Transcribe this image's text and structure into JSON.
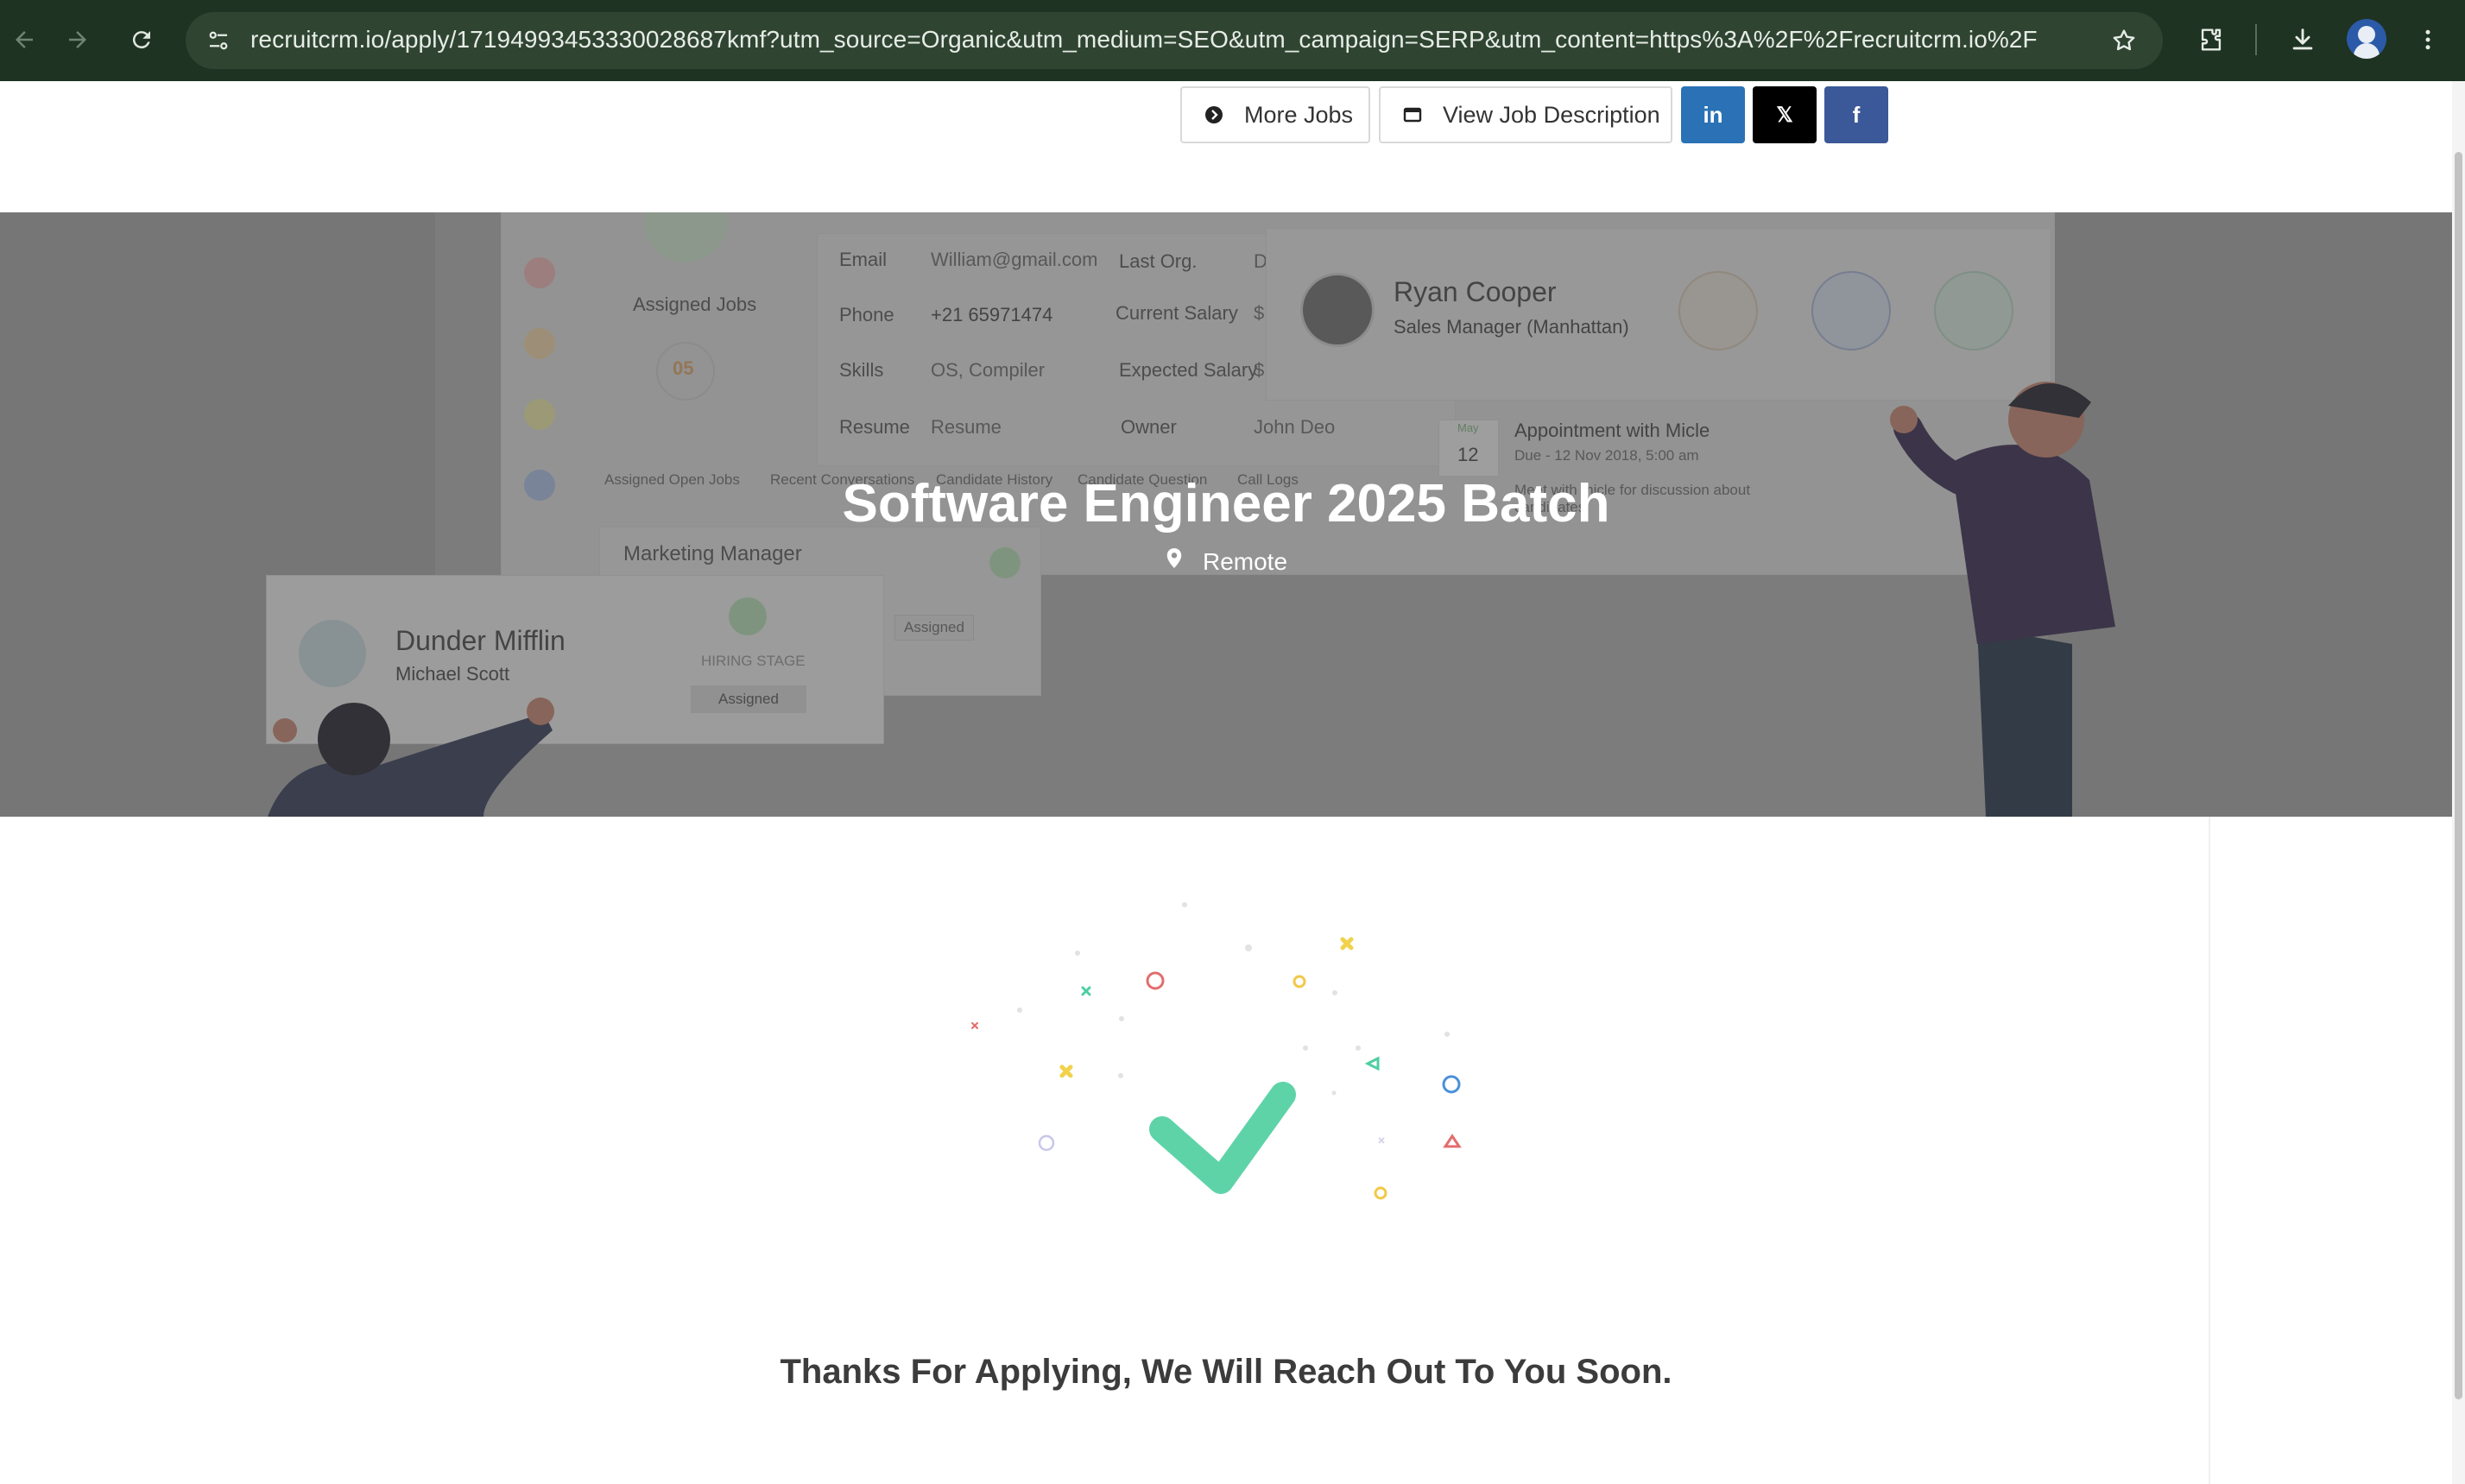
{
  "browser": {
    "url": "recruitcrm.io/apply/17194993453330028687kmf?utm_source=Organic&utm_medium=SEO&utm_campaign=SERP&utm_content=https%3A%2F%2Frecruitcrm.io%2F",
    "icons": [
      "back-arrow-icon",
      "forward-arrow-icon",
      "reload-icon",
      "site-settings-icon",
      "bookmark-star-icon",
      "extensions-icon",
      "downloads-icon",
      "profile-avatar",
      "more-menu-icon"
    ]
  },
  "topbar": {
    "more_jobs_label": "More Jobs",
    "view_description_label": "View Job Description",
    "linkedin_label": "in",
    "x_label": "𝕏",
    "facebook_label": "f"
  },
  "job": {
    "title": "Software Engineer 2025 Batch",
    "location": "Remote"
  },
  "hero_backdrop": {
    "assigned_jobs_label": "Assigned Jobs",
    "assigned_jobs_count": "05",
    "fields": [
      {
        "label": "Email",
        "value": "William@gmail.com"
      },
      {
        "label": "Phone",
        "value": "+21 65971474"
      },
      {
        "label": "Skills",
        "value": "OS, Compiler"
      },
      {
        "label": "Resume",
        "value": "Resume"
      }
    ],
    "fields_right": [
      {
        "label": "Last Org.",
        "value": "D"
      },
      {
        "label": "Current Salary",
        "value": "$"
      },
      {
        "label": "Expected Salary",
        "value": "$"
      },
      {
        "label": "Owner",
        "value": "John Deo"
      }
    ],
    "tabs": [
      "Assigned Open Jobs",
      "Recent Conversations",
      "Candidate History",
      "Candidate Question",
      "Call Logs"
    ],
    "profile_name": "Ryan Cooper",
    "profile_role": "Sales Manager (Manhattan)",
    "appointment_month": "May",
    "appointment_day": "12",
    "appointment_title": "Appointment with Micle",
    "appointment_due": "Due - 12 Nov 2018, 5:00 am",
    "appointment_note": "Meet with micle for discussion about candidates",
    "company_name": "Dunder Mifflin",
    "company_contact": "Michael Scott",
    "marketing_label": "Marketing Manager",
    "hiring_stage_label": "HIRING STAGE",
    "hiring_stage_value": "Assigned",
    "hiring_stage_value_2": "Assigned"
  },
  "confirmation": {
    "message": "Thanks For Applying, We Will Reach Out To You Soon.",
    "check_color": "#5fd3a8"
  }
}
